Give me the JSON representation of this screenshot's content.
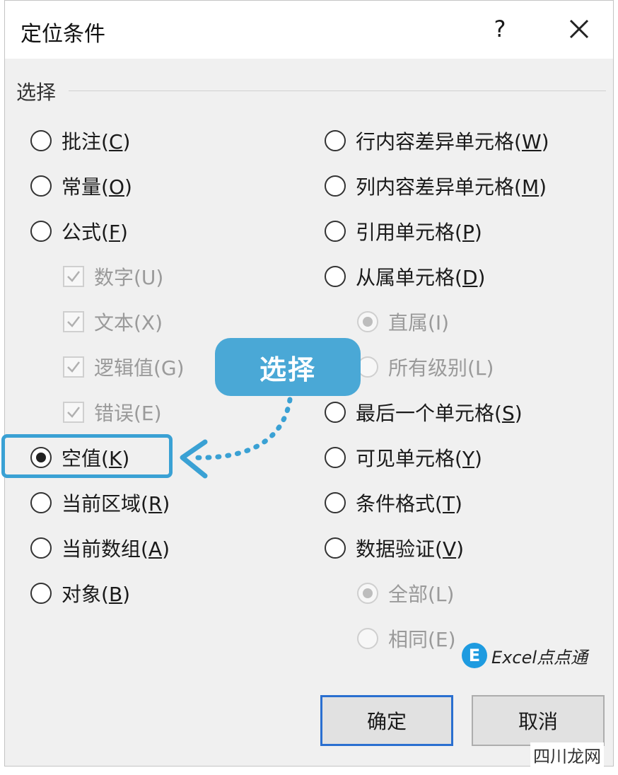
{
  "dialog": {
    "title": "定位条件",
    "help_label": "?",
    "group_label": "选择"
  },
  "left_options": [
    {
      "text": "批注(",
      "key": "C",
      "tail": ")",
      "kind": "radio",
      "selected": false,
      "disabled": false
    },
    {
      "text": "常量(",
      "key": "O",
      "tail": ")",
      "kind": "radio",
      "selected": false,
      "disabled": false
    },
    {
      "text": "公式(",
      "key": "F",
      "tail": ")",
      "kind": "radio",
      "selected": false,
      "disabled": false
    },
    {
      "text": "数字(U)",
      "kind": "checkbox",
      "checked": true,
      "disabled": true
    },
    {
      "text": "文本(X)",
      "kind": "checkbox",
      "checked": true,
      "disabled": true
    },
    {
      "text": "逻辑值(G)",
      "kind": "checkbox",
      "checked": true,
      "disabled": true
    },
    {
      "text": "错误(E)",
      "kind": "checkbox",
      "checked": true,
      "disabled": true
    },
    {
      "text": "空值(",
      "key": "K",
      "tail": ")",
      "kind": "radio",
      "selected": true,
      "disabled": false
    },
    {
      "text": "当前区域(",
      "key": "R",
      "tail": ")",
      "kind": "radio",
      "selected": false,
      "disabled": false
    },
    {
      "text": "当前数组(",
      "key": "A",
      "tail": ")",
      "kind": "radio",
      "selected": false,
      "disabled": false
    },
    {
      "text": "对象(",
      "key": "B",
      "tail": ")",
      "kind": "radio",
      "selected": false,
      "disabled": false
    }
  ],
  "right_options": [
    {
      "text": "行内容差异单元格(",
      "key": "W",
      "tail": ")",
      "kind": "radio",
      "selected": false,
      "disabled": false
    },
    {
      "text": "列内容差异单元格(",
      "key": "M",
      "tail": ")",
      "kind": "radio",
      "selected": false,
      "disabled": false
    },
    {
      "text": "引用单元格(",
      "key": "P",
      "tail": ")",
      "kind": "radio",
      "selected": false,
      "disabled": false
    },
    {
      "text": "从属单元格(",
      "key": "D",
      "tail": ")",
      "kind": "radio",
      "selected": false,
      "disabled": false
    },
    {
      "text": "直属(I)",
      "kind": "radio",
      "selected": true,
      "disabled": true
    },
    {
      "text": "所有级别(L)",
      "kind": "radio",
      "selected": false,
      "disabled": true
    },
    {
      "text": "最后一个单元格(",
      "key": "S",
      "tail": ")",
      "kind": "radio",
      "selected": false,
      "disabled": false
    },
    {
      "text": "可见单元格(",
      "key": "Y",
      "tail": ")",
      "kind": "radio",
      "selected": false,
      "disabled": false
    },
    {
      "text": "条件格式(",
      "key": "T",
      "tail": ")",
      "kind": "radio",
      "selected": false,
      "disabled": false
    },
    {
      "text": "数据验证(",
      "key": "V",
      "tail": ")",
      "kind": "radio",
      "selected": false,
      "disabled": false
    },
    {
      "text": "全部(L)",
      "kind": "radio",
      "selected": true,
      "disabled": true
    },
    {
      "text": "相同(E)",
      "kind": "radio",
      "selected": false,
      "disabled": true
    }
  ],
  "callout": {
    "text": "选择"
  },
  "buttons": {
    "ok": "确定",
    "cancel": "取消"
  },
  "watermark": {
    "logo_letter": "E",
    "text": "Excel点点通"
  },
  "site_mark": "四川龙网",
  "colors": {
    "callout": "#4aa8d6",
    "highlight": "#3aa1d4",
    "primary_border": "#2a6fd0"
  }
}
